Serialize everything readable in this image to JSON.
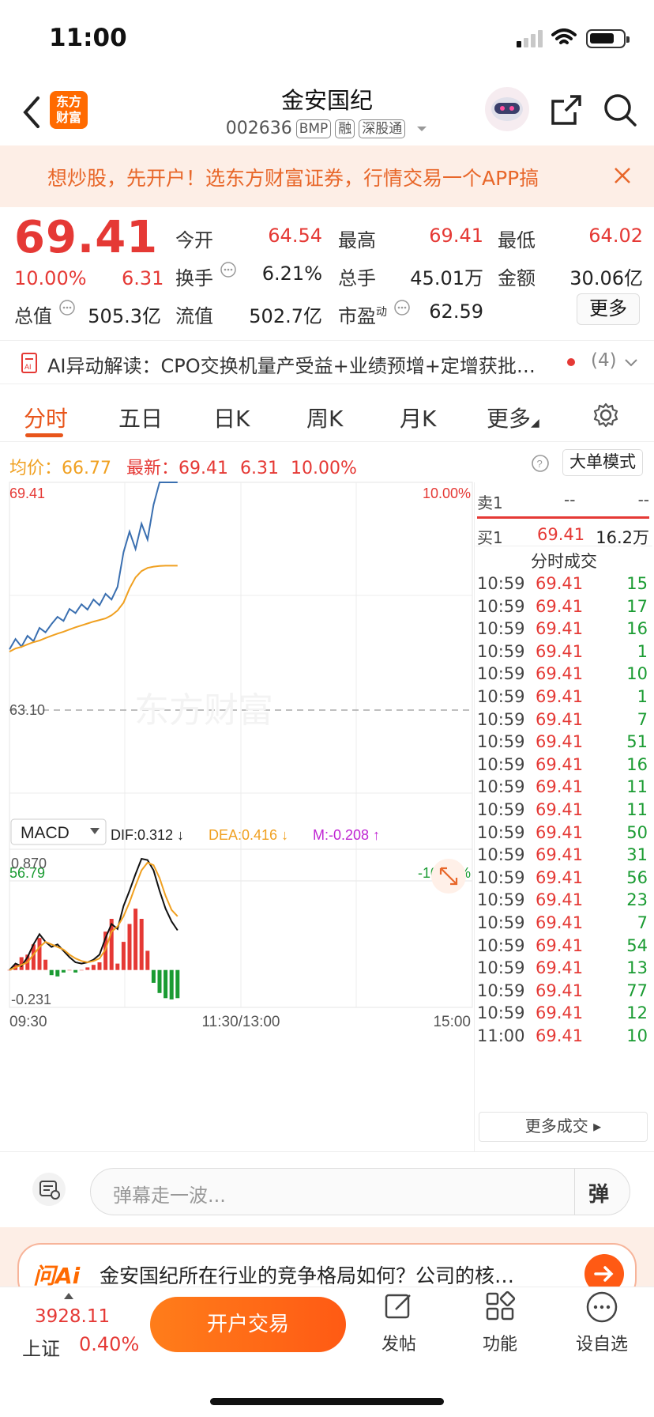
{
  "status": {
    "time": "11:00"
  },
  "header": {
    "logo": [
      "东方",
      "财富"
    ],
    "name": "金安国纪",
    "code": "002636",
    "tags": [
      "BMP",
      "融",
      "深股通"
    ]
  },
  "banner": {
    "text": "想炒股，先开户！选东方财富证券，行情交易一个APP搞"
  },
  "quote": {
    "price": "69.41",
    "pct": "10.00%",
    "change": "6.31",
    "rows": [
      [
        {
          "label": "今开",
          "value": "64.54",
          "color": "red"
        },
        {
          "label": "最高",
          "value": "69.41",
          "color": "red"
        },
        {
          "label": "最低",
          "value": "64.02",
          "color": "red"
        }
      ],
      [
        {
          "label": "换手",
          "value": "6.21%",
          "color": "black"
        },
        {
          "label": "总手",
          "value": "45.01万",
          "color": "black"
        },
        {
          "label": "金额",
          "value": "30.06亿",
          "color": "black"
        }
      ]
    ],
    "cap_label": "总值",
    "cap_value": "505.3亿",
    "float_label": "流值",
    "float_value": "502.7亿",
    "pe_label": "市盈",
    "pe_sup": "动",
    "pe_value": "62.59",
    "more": "更多"
  },
  "ai": {
    "label": "AI异动解读：",
    "text": "CPO交换机量产受益+业绩预增+定增获批…",
    "count": "(4)"
  },
  "tabs": [
    "分时",
    "五日",
    "日K",
    "周K",
    "月K",
    "更多"
  ],
  "infobar": {
    "avg_label": "均价：",
    "avg_value": "66.77",
    "latest_label": "最新：",
    "latest_value": "69.41",
    "latest_change": "6.31",
    "latest_pct": "10.00%",
    "mode_btn": "大单模式"
  },
  "chart": {
    "top_price": "69.41",
    "top_pct": "10.00%",
    "mid_price": "63.10",
    "bottom_price": "56.79",
    "bottom_pct": "-10.00%",
    "watermark": "东方财富",
    "time_labels": [
      "09:30",
      "11:30/13:00",
      "15:00"
    ]
  },
  "chart_data": {
    "type": "line",
    "x_range": [
      "09:30",
      "15:00"
    ],
    "ylim": [
      56.79,
      69.41
    ],
    "reference": 63.1,
    "series": [
      {
        "values": [
          64.12,
          64.45,
          64.21,
          64.55,
          64.38,
          64.8,
          64.66,
          64.92,
          65.15,
          65.02,
          65.4,
          65.27,
          65.55,
          65.38,
          65.7,
          65.52,
          65.88,
          65.7,
          66.1,
          67.2,
          67.85,
          67.3,
          68.1,
          67.6,
          68.7,
          69.41,
          69.41,
          69.41,
          69.41
        ]
      },
      {
        "values": [
          64.05,
          64.15,
          64.2,
          64.28,
          64.35,
          64.4,
          64.48,
          64.55,
          64.62,
          64.68,
          64.75,
          64.82,
          64.88,
          64.94,
          65.0,
          65.05,
          65.1,
          65.2,
          65.35,
          65.6,
          66.05,
          66.4,
          66.6,
          66.7,
          66.74,
          66.76,
          66.77,
          66.77,
          66.77
        ]
      }
    ]
  },
  "macd": {
    "selector": "MACD",
    "dif": "DIF:0.312",
    "dea": "DEA:0.416",
    "m": "M:-0.208",
    "top": "0.870",
    "bottom": "-0.231",
    "ylim": [
      -0.231,
      0.87
    ],
    "dif_values": [
      0.0,
      0.05,
      0.03,
      0.1,
      0.2,
      0.28,
      0.22,
      0.18,
      0.2,
      0.15,
      0.1,
      0.06,
      0.05,
      0.06,
      0.08,
      0.12,
      0.25,
      0.36,
      0.32,
      0.5,
      0.62,
      0.75,
      0.87,
      0.86,
      0.78,
      0.62,
      0.48,
      0.38,
      0.31
    ],
    "dea_values": [
      0.0,
      0.02,
      0.04,
      0.06,
      0.12,
      0.18,
      0.22,
      0.2,
      0.18,
      0.16,
      0.12,
      0.09,
      0.07,
      0.06,
      0.07,
      0.09,
      0.16,
      0.3,
      0.34,
      0.42,
      0.53,
      0.66,
      0.78,
      0.84,
      0.82,
      0.72,
      0.58,
      0.47,
      0.42
    ],
    "hist_values": [
      0.0,
      0.04,
      0.1,
      0.12,
      0.2,
      0.25,
      0.08,
      -0.04,
      -0.05,
      -0.02,
      0.0,
      -0.02,
      0.0,
      0.02,
      0.04,
      0.06,
      0.3,
      0.4,
      0.05,
      0.22,
      0.36,
      0.48,
      0.4,
      0.15,
      -0.1,
      -0.18,
      -0.22,
      -0.23,
      -0.22
    ]
  },
  "orderbook": {
    "sell_label": "卖1",
    "sell_price": "--",
    "sell_vol": "--",
    "buy_label": "买1",
    "buy_price": "69.41",
    "buy_vol": "16.2万",
    "title": "分时成交",
    "more": "更多成交"
  },
  "trades": [
    {
      "t": "10:59",
      "p": "69.41",
      "v": "15"
    },
    {
      "t": "10:59",
      "p": "69.41",
      "v": "17"
    },
    {
      "t": "10:59",
      "p": "69.41",
      "v": "16"
    },
    {
      "t": "10:59",
      "p": "69.41",
      "v": "1"
    },
    {
      "t": "10:59",
      "p": "69.41",
      "v": "10"
    },
    {
      "t": "10:59",
      "p": "69.41",
      "v": "1"
    },
    {
      "t": "10:59",
      "p": "69.41",
      "v": "7"
    },
    {
      "t": "10:59",
      "p": "69.41",
      "v": "51"
    },
    {
      "t": "10:59",
      "p": "69.41",
      "v": "16"
    },
    {
      "t": "10:59",
      "p": "69.41",
      "v": "11"
    },
    {
      "t": "10:59",
      "p": "69.41",
      "v": "11"
    },
    {
      "t": "10:59",
      "p": "69.41",
      "v": "50"
    },
    {
      "t": "10:59",
      "p": "69.41",
      "v": "31"
    },
    {
      "t": "10:59",
      "p": "69.41",
      "v": "56"
    },
    {
      "t": "10:59",
      "p": "69.41",
      "v": "23"
    },
    {
      "t": "10:59",
      "p": "69.41",
      "v": "7"
    },
    {
      "t": "10:59",
      "p": "69.41",
      "v": "54"
    },
    {
      "t": "10:59",
      "p": "69.41",
      "v": "13"
    },
    {
      "t": "10:59",
      "p": "69.41",
      "v": "77"
    },
    {
      "t": "10:59",
      "p": "69.41",
      "v": "12"
    },
    {
      "t": "11:00",
      "p": "69.41",
      "v": "10"
    }
  ],
  "chatbar": {
    "placeholder": "弹幕走一波...",
    "danmu_btn": "弹"
  },
  "askai": {
    "logo": "问Ai",
    "text": "金安国纪所在行业的竞争格局如何？公司的核…"
  },
  "bottom": {
    "index_value": "3928.11",
    "index_name": "上证",
    "index_pct": "0.40%",
    "trade_btn": "开户交易",
    "post": "发帖",
    "func": "功能",
    "watch": "设自选"
  },
  "colors": {
    "accent": "#e8551b",
    "up": "#e53935",
    "down": "#1a9b32",
    "avg_line": "#f0a020",
    "price_line": "#3a6fb0"
  }
}
